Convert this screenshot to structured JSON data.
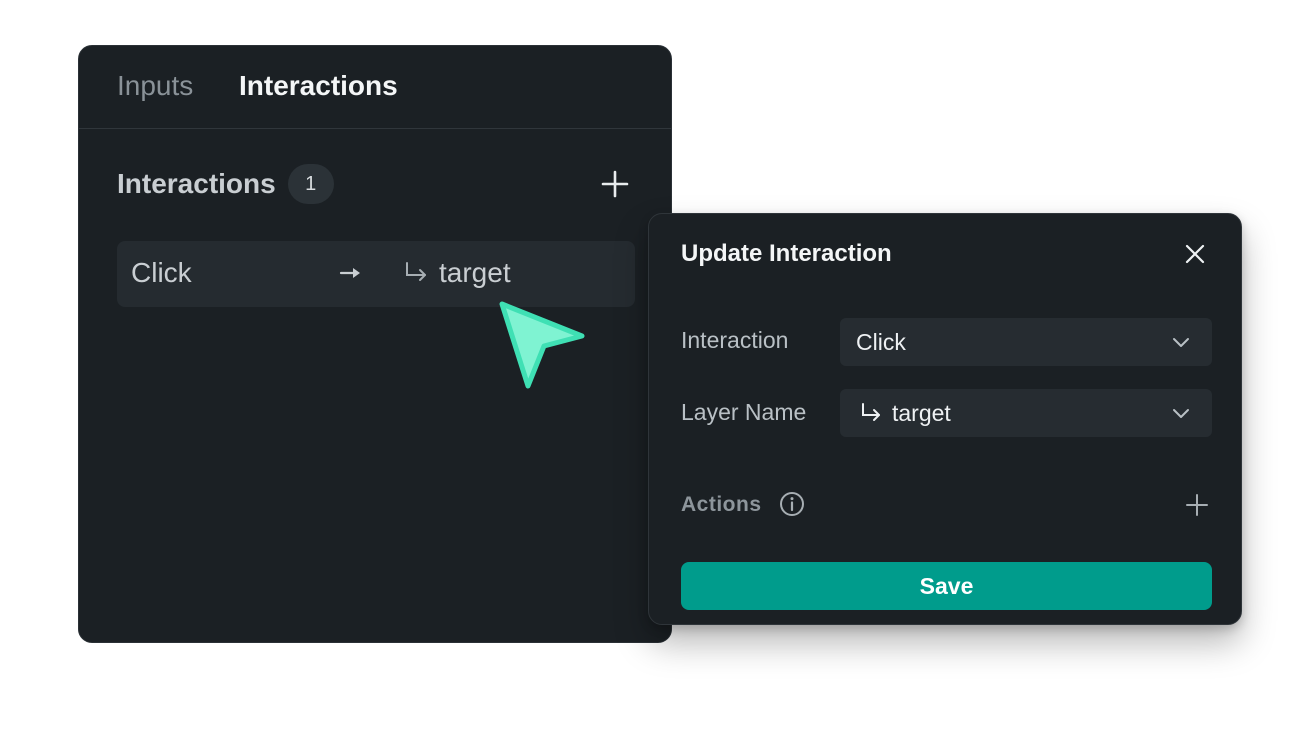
{
  "tabs": {
    "inputs": "Inputs",
    "interactions": "Interactions"
  },
  "section": {
    "title": "Interactions",
    "count": "1"
  },
  "interaction_row": {
    "trigger": "Click",
    "target": "target"
  },
  "modal": {
    "title": "Update Interaction",
    "interaction_label": "Interaction",
    "interaction_value": "Click",
    "layer_label": "Layer Name",
    "layer_value": "target",
    "actions_label": "Actions",
    "save_label": "Save"
  },
  "colors": {
    "accent": "#009c8c",
    "cursor": "#6ef0cc",
    "panel_bg": "#1b2024"
  },
  "icons": [
    "add-icon",
    "arrow-right-icon",
    "layer-link-icon",
    "cursor-icon",
    "close-icon",
    "chevron-down-icon",
    "info-icon"
  ]
}
